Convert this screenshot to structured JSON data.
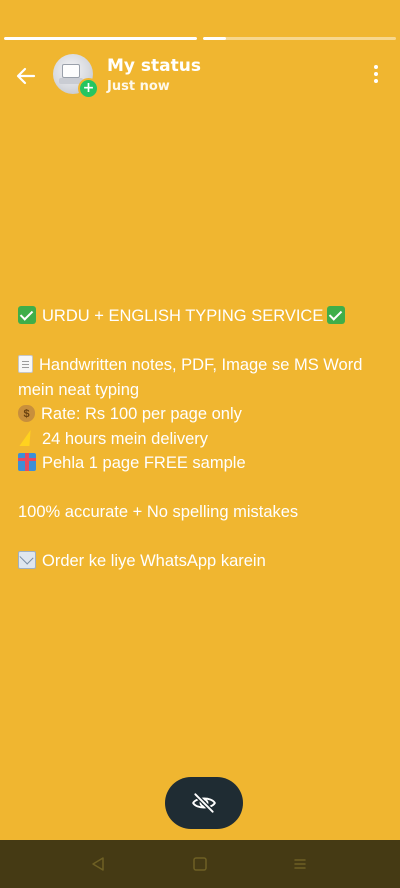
{
  "header": {
    "title": "My status",
    "subtitle": "Just now",
    "back_icon": "arrow-left-icon",
    "menu_icon": "more-vertical-icon"
  },
  "progress": {
    "segments": [
      {
        "fill": 1.0
      },
      {
        "fill": 0.12
      }
    ]
  },
  "status": {
    "background_color": "#f0b630",
    "lines": {
      "heading": "URDU + ENGLISH TYPING SERVICE",
      "service": "Handwritten notes, PDF, Image se MS Word mein neat typing",
      "rate": "Rate: Rs 100 per page only",
      "delivery": "24 hours mein delivery",
      "sample": "Pehla 1 page FREE sample",
      "accuracy": "100% accurate + No spelling mistakes",
      "order": "Order ke liye WhatsApp karein"
    }
  },
  "fab": {
    "icon": "eye-off-icon"
  },
  "navbar": {
    "icons": [
      "nav-back-icon",
      "nav-home-icon",
      "nav-menu-icon"
    ]
  }
}
